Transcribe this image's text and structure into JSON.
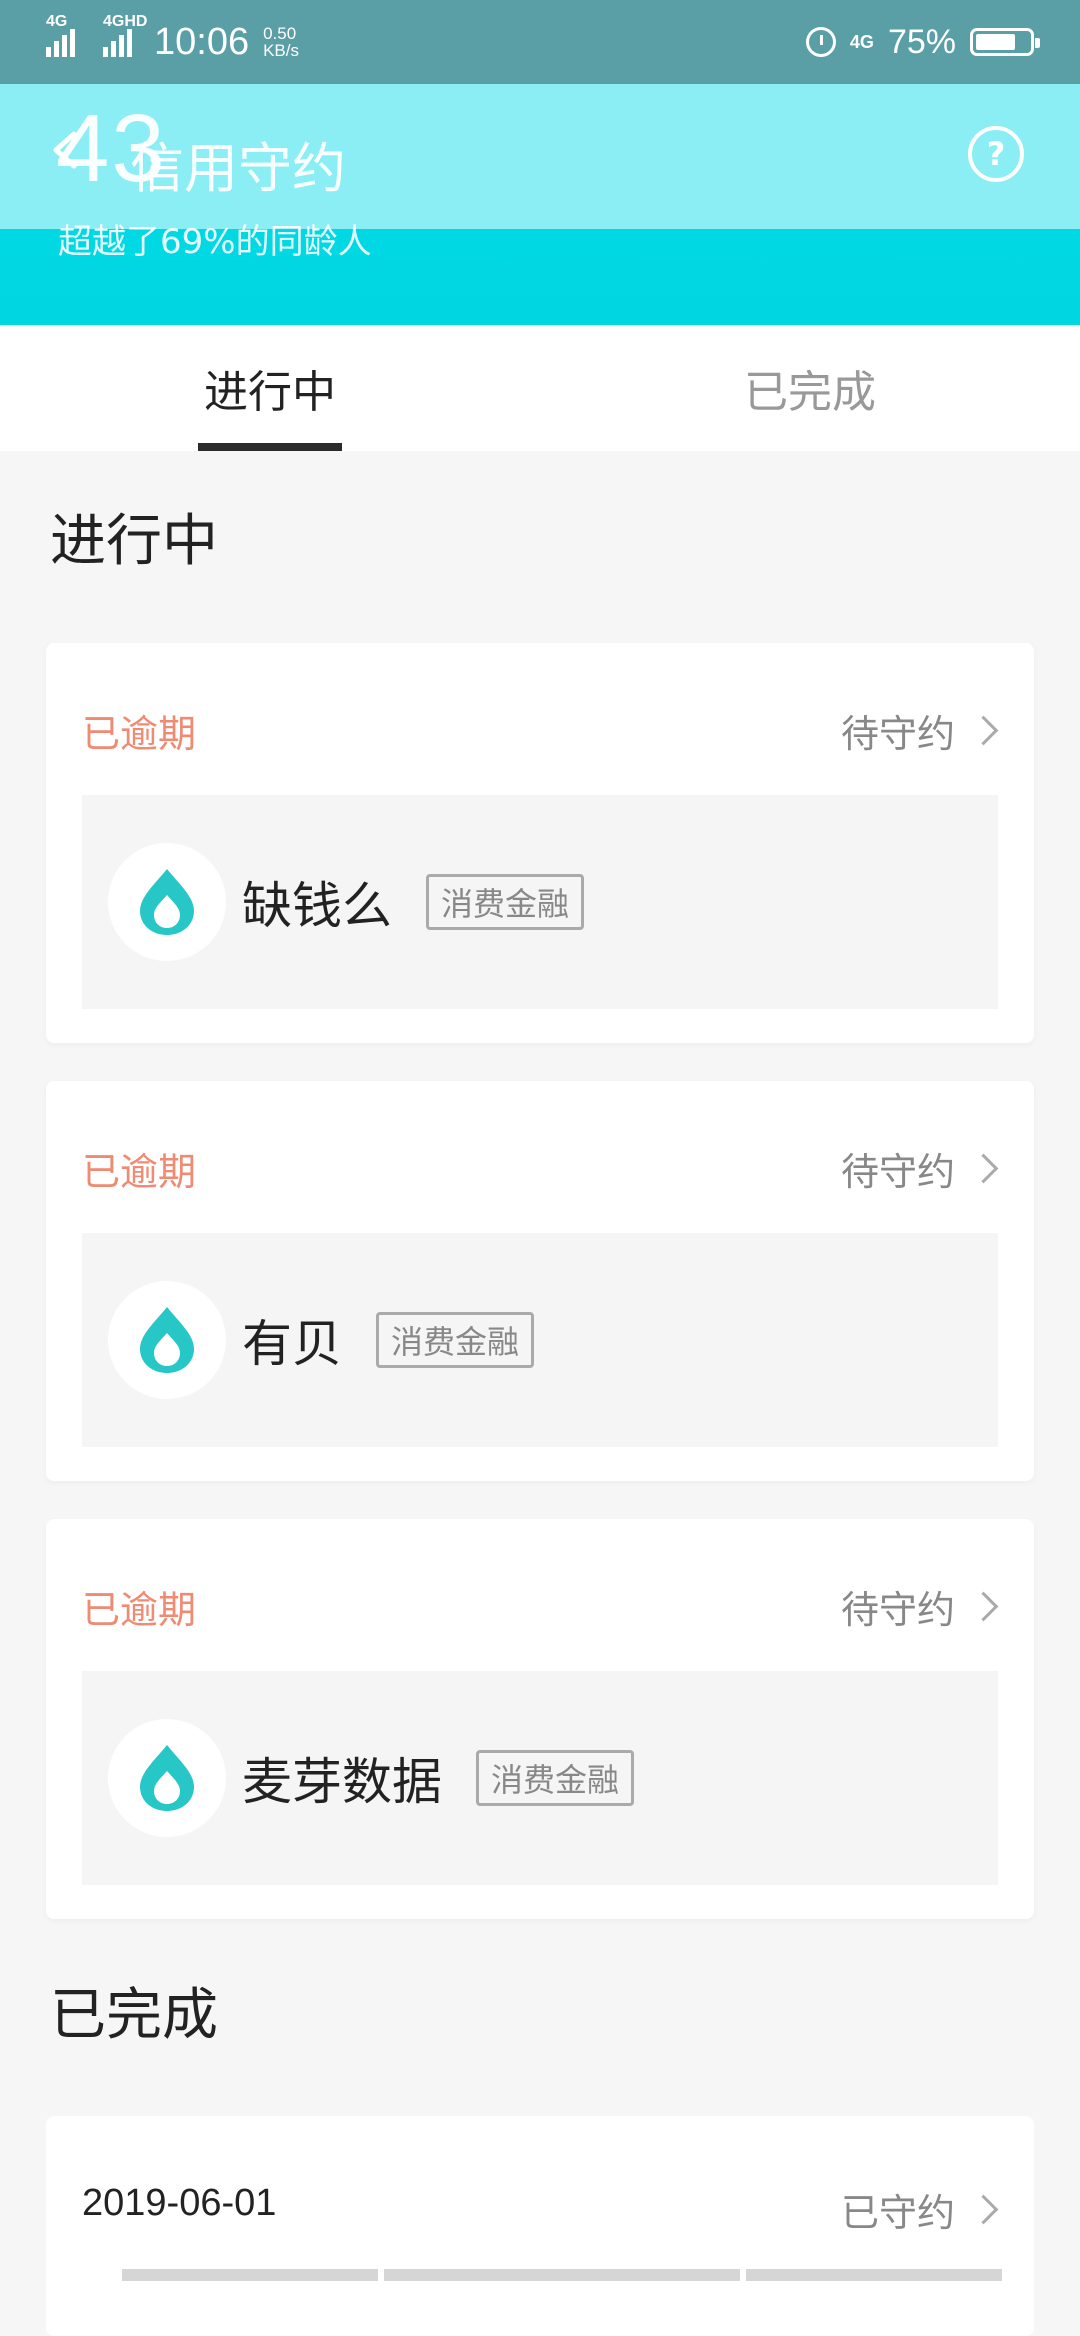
{
  "status_bar": {
    "sig1_label": "4G",
    "sig2_label": "4GHD",
    "time": "10:06",
    "speed_value": "0.50",
    "speed_unit": "KB/s",
    "net": "4G",
    "battery_percent": "75%",
    "battery_level": 0.75
  },
  "header": {
    "score": "43",
    "title": "信用守约",
    "subtitle": "超越了69%的同龄人",
    "help_symbol": "?"
  },
  "tabs": [
    {
      "label": "进行中",
      "active": true
    },
    {
      "label": "已完成",
      "active": false
    }
  ],
  "sections": {
    "in_progress_title": "进行中",
    "completed_title": "已完成"
  },
  "in_progress_cards": [
    {
      "status": "已逾期",
      "state": "待守约",
      "company": "缺钱么",
      "tag": "消费金融"
    },
    {
      "status": "已逾期",
      "state": "待守约",
      "company": "有贝",
      "tag": "消费金融"
    },
    {
      "status": "已逾期",
      "state": "待守约",
      "company": "麦芽数据",
      "tag": "消费金融"
    }
  ],
  "completed_cards": [
    {
      "date": "2019-06-01",
      "state": "已守约"
    }
  ],
  "colors": {
    "overdue": "#ef8a73",
    "accent": "#00d8e4",
    "logo_teal": "#27c6c7"
  }
}
